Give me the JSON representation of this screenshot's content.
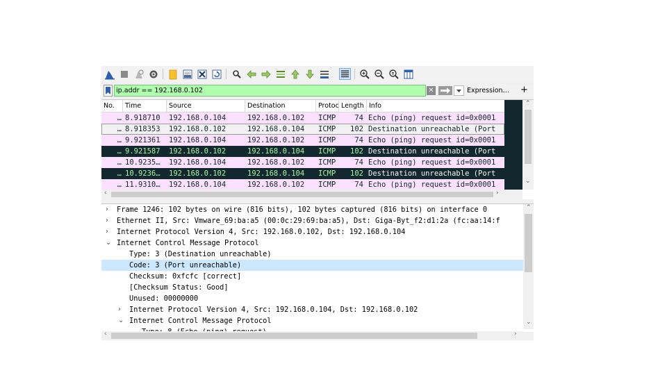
{
  "toolbar": {
    "icons": [
      "shark-fin-start-icon",
      "stop-icon",
      "restart-icon",
      "options-gear-icon",
      "open-folder-icon",
      "save-file-icon",
      "close-file-icon",
      "reload-icon",
      "find-icon",
      "back-arrow-icon",
      "forward-arrow-icon",
      "go-to-packet-icon",
      "first-packet-icon",
      "last-packet-icon",
      "autoscroll-icon",
      "colorize-icon",
      "zoom-in-icon",
      "zoom-out-icon",
      "normal-size-icon",
      "resize-columns-icon"
    ]
  },
  "filter": {
    "value": "ip.addr == 192.168.0.102",
    "expression_label": "Expression…",
    "add_label": "+",
    "clear_label": "✕"
  },
  "packet_list": {
    "columns": [
      "No.",
      "Time",
      "Source",
      "Destination",
      "Protocol",
      "Length",
      "Info"
    ],
    "rows": [
      {
        "no": "…",
        "time": "8.918710",
        "src": "192.168.0.104",
        "dst": "192.168.0.102",
        "proto": "ICMP",
        "len": "74",
        "info": "Echo (ping) request  id=0x0001",
        "style": "icmp"
      },
      {
        "no": "…",
        "time": "8.918353",
        "src": "192.168.0.102",
        "dst": "192.168.0.104",
        "proto": "ICMP",
        "len": "102",
        "info": "Destination unreachable (Port",
        "style": "sel"
      },
      {
        "no": "…",
        "time": "9.921361",
        "src": "192.168.0.104",
        "dst": "192.168.0.102",
        "proto": "ICMP",
        "len": "74",
        "info": "Echo (ping) request  id=0x0001",
        "style": "icmp"
      },
      {
        "no": "…",
        "time": "9.921587",
        "src": "192.168.0.102",
        "dst": "192.168.0.104",
        "proto": "ICMP",
        "len": "102",
        "info": "Destination unreachable (Port",
        "style": "err"
      },
      {
        "no": "…",
        "time": "10.9235…",
        "src": "192.168.0.104",
        "dst": "192.168.0.102",
        "proto": "ICMP",
        "len": "74",
        "info": "Echo (ping) request  id=0x0001",
        "style": "icmp"
      },
      {
        "no": "…",
        "time": "10.9236…",
        "src": "192.168.0.102",
        "dst": "192.168.0.104",
        "proto": "ICMP",
        "len": "102",
        "info": "Destination unreachable (Port",
        "style": "err"
      },
      {
        "no": "…",
        "time": "11.9310…",
        "src": "192.168.0.104",
        "dst": "192.168.0.102",
        "proto": "ICMP",
        "len": "74",
        "info": "Echo (ping) request  id=0x0001",
        "style": "icmp"
      }
    ]
  },
  "details": {
    "rows": [
      {
        "twisty": "›",
        "text": "Frame 1246: 102 bytes on wire (816 bits), 102 bytes captured (816 bits) on interface 0",
        "indent": 0,
        "hl": false
      },
      {
        "twisty": "›",
        "text": "Ethernet II, Src: Vmware_69:ba:a5 (00:0c:29:69:ba:a5), Dst: Giga-Byt_f2:d1:2a (fc:aa:14:f",
        "indent": 0,
        "hl": false
      },
      {
        "twisty": "›",
        "text": "Internet Protocol Version 4, Src: 192.168.0.102, Dst: 192.168.0.104",
        "indent": 0,
        "hl": false
      },
      {
        "twisty": "⌄",
        "text": "Internet Control Message Protocol",
        "indent": 0,
        "hl": false
      },
      {
        "twisty": "",
        "text": "Type: 3 (Destination unreachable)",
        "indent": 1,
        "hl": false
      },
      {
        "twisty": "",
        "text": "Code: 3 (Port unreachable)",
        "indent": 1,
        "hl": true
      },
      {
        "twisty": "",
        "text": "Checksum: 0xfcfc [correct]",
        "indent": 1,
        "hl": false
      },
      {
        "twisty": "",
        "text": "[Checksum Status: Good]",
        "indent": 1,
        "hl": false
      },
      {
        "twisty": "",
        "text": "Unused: 00000000",
        "indent": 1,
        "hl": false
      },
      {
        "twisty": "›",
        "text": "Internet Protocol Version 4, Src: 192.168.0.104, Dst: 192.168.0.102",
        "indent": 1,
        "hl": false
      },
      {
        "twisty": "⌄",
        "text": "Internet Control Message Protocol",
        "indent": 1,
        "hl": false
      },
      {
        "twisty": "",
        "text": "Type: 8 (Echo (ping) request)",
        "indent": 2,
        "hl": false
      }
    ]
  },
  "colors": {
    "filter_valid": "#afffaf",
    "icmp_row": "#fce0ff",
    "error_row_bg": "#12272e",
    "error_row_fg": "#a3f7a3",
    "selected_detail": "#cce8ff"
  }
}
